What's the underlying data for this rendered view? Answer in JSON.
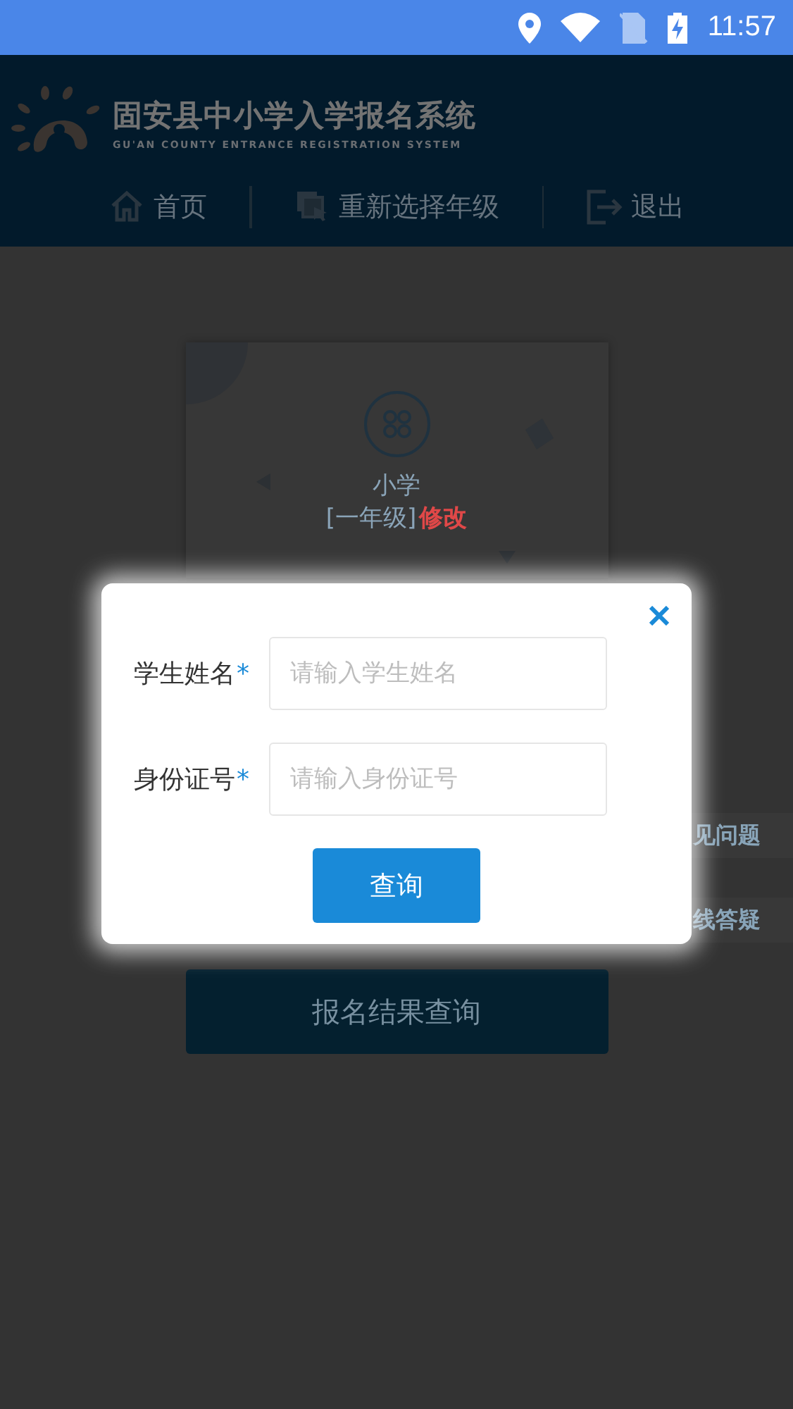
{
  "status_bar": {
    "time": "11:57"
  },
  "header": {
    "title": "固安县中小学入学报名系统",
    "subtitle": "GU'AN COUNTY ENTRANCE REGISTRATION SYSTEM",
    "nav": [
      {
        "label": "首页",
        "kind": "home"
      },
      {
        "label": "重新选择年级",
        "kind": "reselect"
      },
      {
        "label": "退出",
        "kind": "exit"
      }
    ]
  },
  "grade_card": {
    "level_name": "小学",
    "grade": "[一年级]",
    "edit_link": "修改"
  },
  "side_tabs": [
    {
      "label": "见问题"
    },
    {
      "label": "线答疑"
    }
  ],
  "result_button": "报名结果查询",
  "dialog": {
    "fields": [
      {
        "label": "学生姓名",
        "mark": "*",
        "placeholder": "请输入学生姓名"
      },
      {
        "label": "身份证号",
        "mark": "*",
        "placeholder": "请输入身份证号"
      }
    ],
    "submit": "查询"
  }
}
